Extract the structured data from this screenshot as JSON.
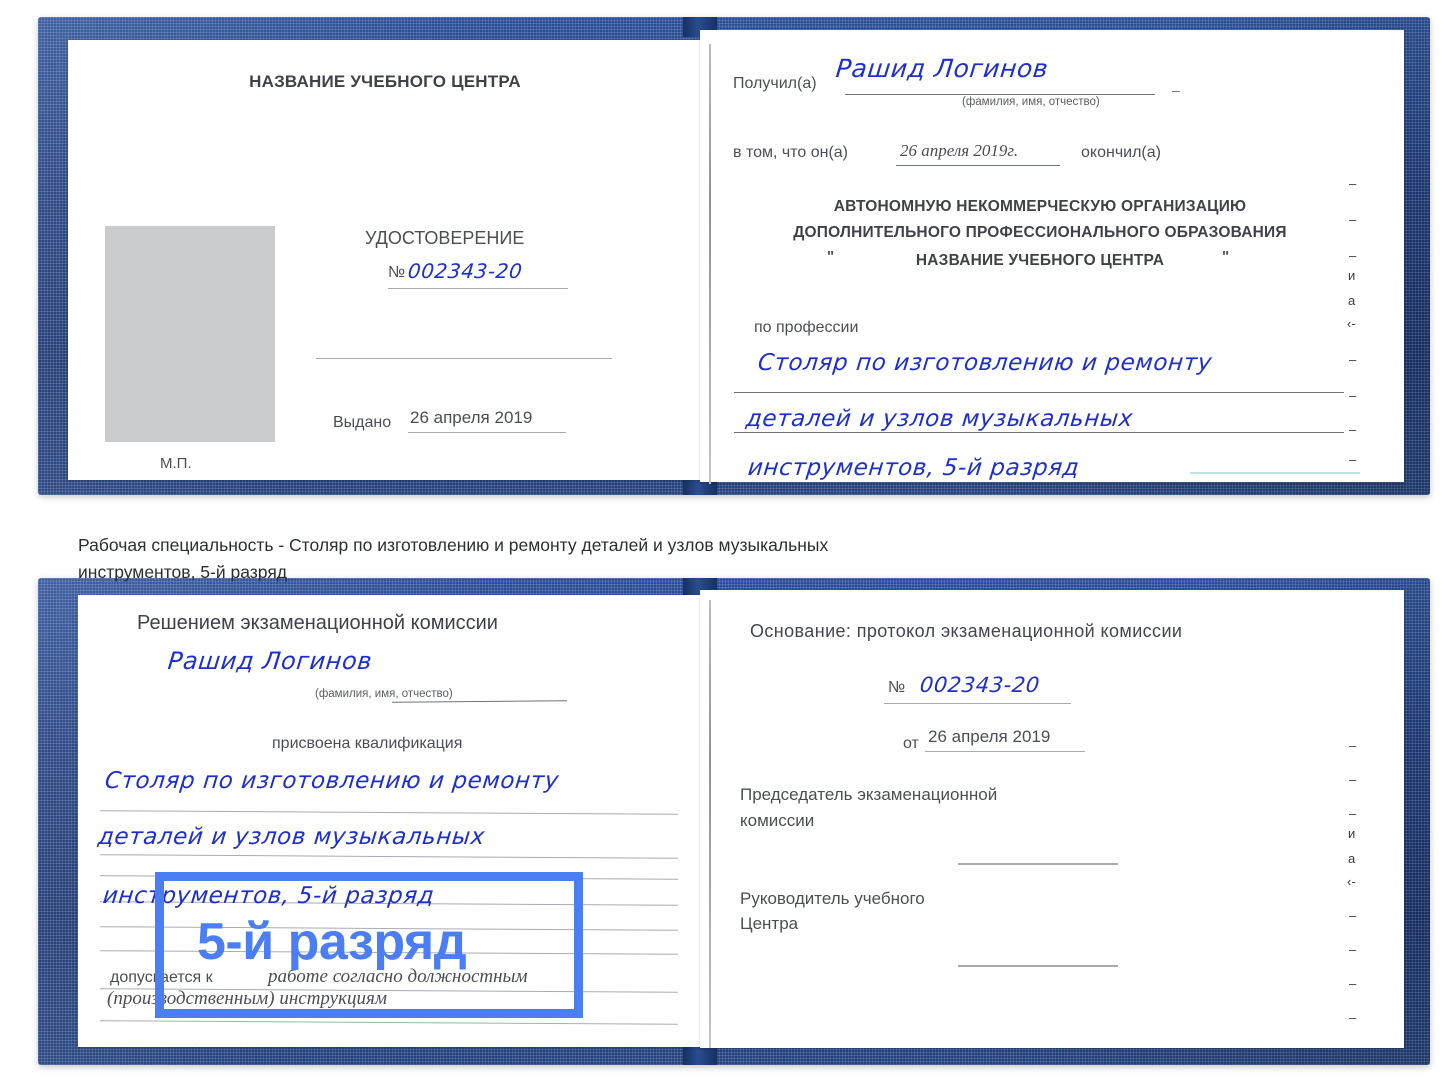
{
  "caption": {
    "line1": "Рабочая специальность - Столяр по изготовлению и ремонту деталей и узлов музыкальных",
    "line2": "инструментов, 5-й разряд"
  },
  "highlight": {
    "label": "5-й разряд",
    "color": "#4a7ef2"
  },
  "certificate_top": {
    "left_page": {
      "header": "НАЗВАНИЕ УЧЕБНОГО ЦЕНТРА",
      "doc_type": "УДОСТОВЕРЕНИЕ",
      "number_label": "№",
      "number_value": "002343-20",
      "issued_label": "Выдано",
      "issued_value": "26 апреля 2019",
      "stamp_label": "М.П."
    },
    "right_page": {
      "received_label": "Получил(а)",
      "received_value": "Рашид Логинов",
      "fio_hint": "(фамилия, имя, отчество)",
      "in_that_label": "в том, что он(а)",
      "in_that_value": "26 апреля 2019г.",
      "finished_label": "окончил(а)",
      "org_line1": "АВТОНОМНУЮ НЕКОММЕРЧЕСКУЮ ОРГАНИЗАЦИЮ",
      "org_line2": "ДОПОЛНИТЕЛЬНОГО ПРОФЕССИОНАЛЬНОГО ОБРАЗОВАНИЯ",
      "org_quote_open": "\"",
      "org_line3": "НАЗВАНИЕ УЧЕБНОГО ЦЕНТРА",
      "org_quote_close": "\"",
      "profession_label": "по профессии",
      "profession_line1": "Столяр по изготовлению и ремонту",
      "profession_line2": "деталей и узлов музыкальных",
      "profession_line3": "инструментов, 5-й разряд"
    },
    "margin_marks": [
      "–",
      "–",
      "–",
      "и",
      "а",
      "‹-",
      "–",
      "–",
      "–",
      "–"
    ]
  },
  "certificate_bottom": {
    "left_page": {
      "header": "Решением экзаменационной комиссии",
      "name_value": "Рашид Логинов",
      "fio_hint": "(фамилия, имя, отчество)",
      "qualification_label": "присвоена квалификация",
      "qualification_line1": "Столяр по изготовлению и ремонту",
      "qualification_line2": "деталей и узлов музыкальных",
      "qualification_line3": "инструментов, 5-й разряд",
      "admitted_label": "допускается к",
      "admitted_value_line1": "работе согласно должностным",
      "admitted_value_line2": "(производственным) инструкциям"
    },
    "right_page": {
      "basis_label": "Основание: протокол экзаменационной комиссии",
      "number_label": "№",
      "number_value": "002343-20",
      "date_label": "от",
      "date_value": "26 апреля 2019",
      "chairman_line1": "Председатель экзаменационной",
      "chairman_line2": "комиссии",
      "head_line1": "Руководитель учебного",
      "head_line2": "Центра"
    },
    "margin_marks": [
      "–",
      "–",
      "–",
      "и",
      "а",
      "‹-",
      "–",
      "–",
      "–",
      "–"
    ]
  }
}
